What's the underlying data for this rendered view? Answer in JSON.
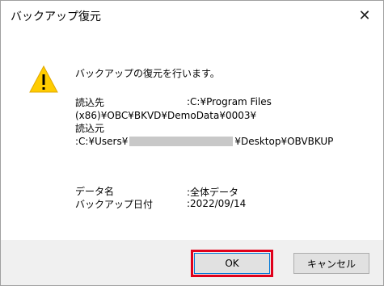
{
  "window": {
    "title": "バックアップ復元",
    "close_glyph": "✕"
  },
  "message": "バックアップの復元を行います。",
  "source": {
    "label": "読込先",
    "value_line1": ":C:¥Program Files",
    "value_line2": "(x86)¥OBC¥BKVD¥DemoData¥0003¥"
  },
  "destination": {
    "label": "読込元",
    "value_prefix": ":C:¥Users¥",
    "value_suffix": "¥Desktop¥OBVBKUP"
  },
  "details": {
    "data_name_label": "データ名",
    "data_name_value": ":全体データ",
    "backup_date_label": "バックアップ日付",
    "backup_date_value": ":2022/09/14"
  },
  "buttons": {
    "ok": "OK",
    "cancel": "キャンセル"
  },
  "icons": {
    "warning": "warning-icon"
  }
}
